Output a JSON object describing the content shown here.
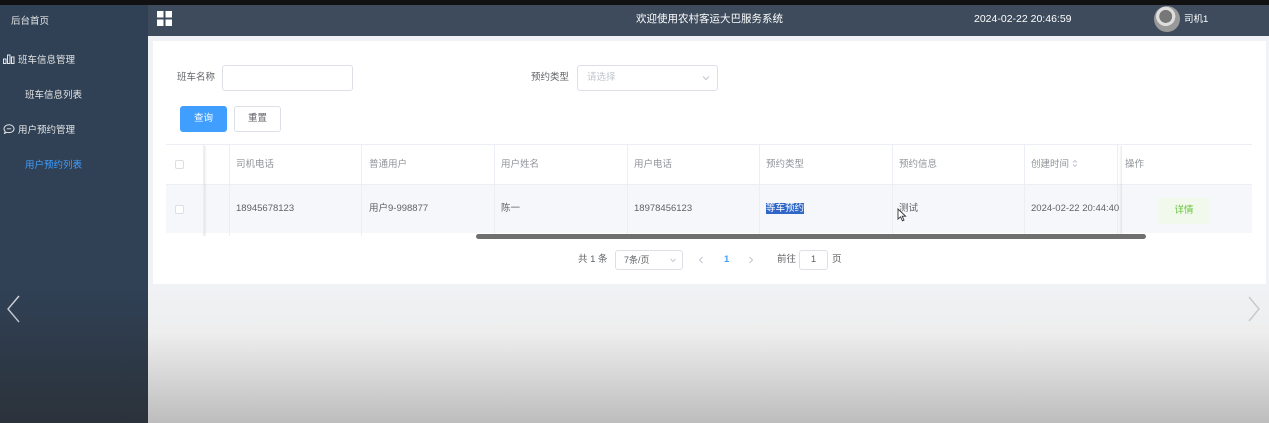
{
  "sidebar": {
    "home": "后台首页",
    "groups": [
      {
        "label": "班车信息管理",
        "icon": "bar-chart-icon",
        "items": [
          "班车信息列表"
        ]
      },
      {
        "label": "用户预约管理",
        "icon": "chat-bubble-icon",
        "items": [
          "用户预约列表"
        ]
      }
    ],
    "active_item": "用户预约列表"
  },
  "header": {
    "title": "欢迎使用农村客运大巴服务系统",
    "datetime": "2024-02-22 20:46:59",
    "username": "司机1"
  },
  "search": {
    "bus_name_label": "班车名称",
    "bus_name_value": "",
    "type_label": "预约类型",
    "type_placeholder": "请选择",
    "query_button": "查询",
    "reset_button": "重置"
  },
  "table": {
    "columns": [
      "司机电话",
      "普通用户",
      "用户姓名",
      "用户电话",
      "预约类型",
      "预约信息",
      "创建时间",
      "操作"
    ],
    "rows": [
      {
        "driver_phone": "18945678123",
        "user": "用户9-998877",
        "user_name": "陈一",
        "user_phone": "18978456123",
        "type": "等车预约",
        "info": "测试",
        "created": "2024-02-22 20:44:40",
        "action": "详情"
      }
    ]
  },
  "pagination": {
    "total": "共 1 条",
    "page_size": "7条/页",
    "current_page": "1",
    "goto_label": "前往",
    "goto_value": "1",
    "page_unit": "页"
  },
  "colors": {
    "sidebar_bg": "#304156",
    "header_bg": "#3d4b5c",
    "primary": "#409eff",
    "success": "#67c23a"
  }
}
